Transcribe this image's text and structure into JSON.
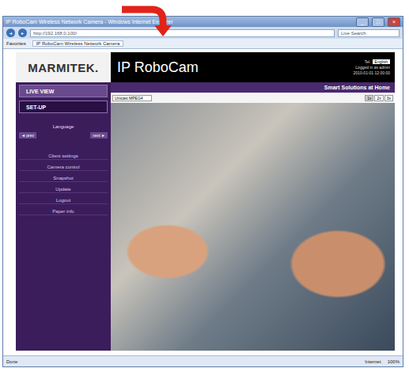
{
  "window": {
    "title": "IP RoboCam Wireless Network Camera - Windows Internet Explorer",
    "controls": [
      "_",
      "□",
      "×"
    ]
  },
  "address": {
    "back": "◄",
    "forward": "►",
    "url": "http://192.168.0.100/",
    "search": "Live Search"
  },
  "favorites": {
    "label": "Favorites",
    "tab": "IP RoboCam Wireless Network Camera"
  },
  "brand": {
    "logo": "MARMITEK.",
    "product": "IP RoboCam",
    "tagline": "Smart Solutions at Home"
  },
  "header_info": {
    "label": "Tel:",
    "language": "English",
    "user": "Logged in as admin",
    "datetime": "2010-01-01 12:00:00"
  },
  "nav": [
    {
      "label": "LIVE VIEW",
      "selected": true
    },
    {
      "label": "SET-UP",
      "selected": false
    }
  ],
  "sidebar": {
    "heading": "Language",
    "buttons": [
      "◄ prev",
      "next ►"
    ],
    "links": [
      "Client settings",
      "Camera control",
      "Snapshot",
      "Update",
      "Logout",
      "Paper info"
    ]
  },
  "stream": {
    "mode": "Unicast MPEG4",
    "sizes": [
      {
        "label": "1x",
        "selected": true
      },
      {
        "label": "2x",
        "selected": false
      },
      {
        "label": "3x",
        "selected": false
      }
    ]
  },
  "status_bar": {
    "text": "Done",
    "zone": "Internet",
    "zoom": "100%"
  }
}
